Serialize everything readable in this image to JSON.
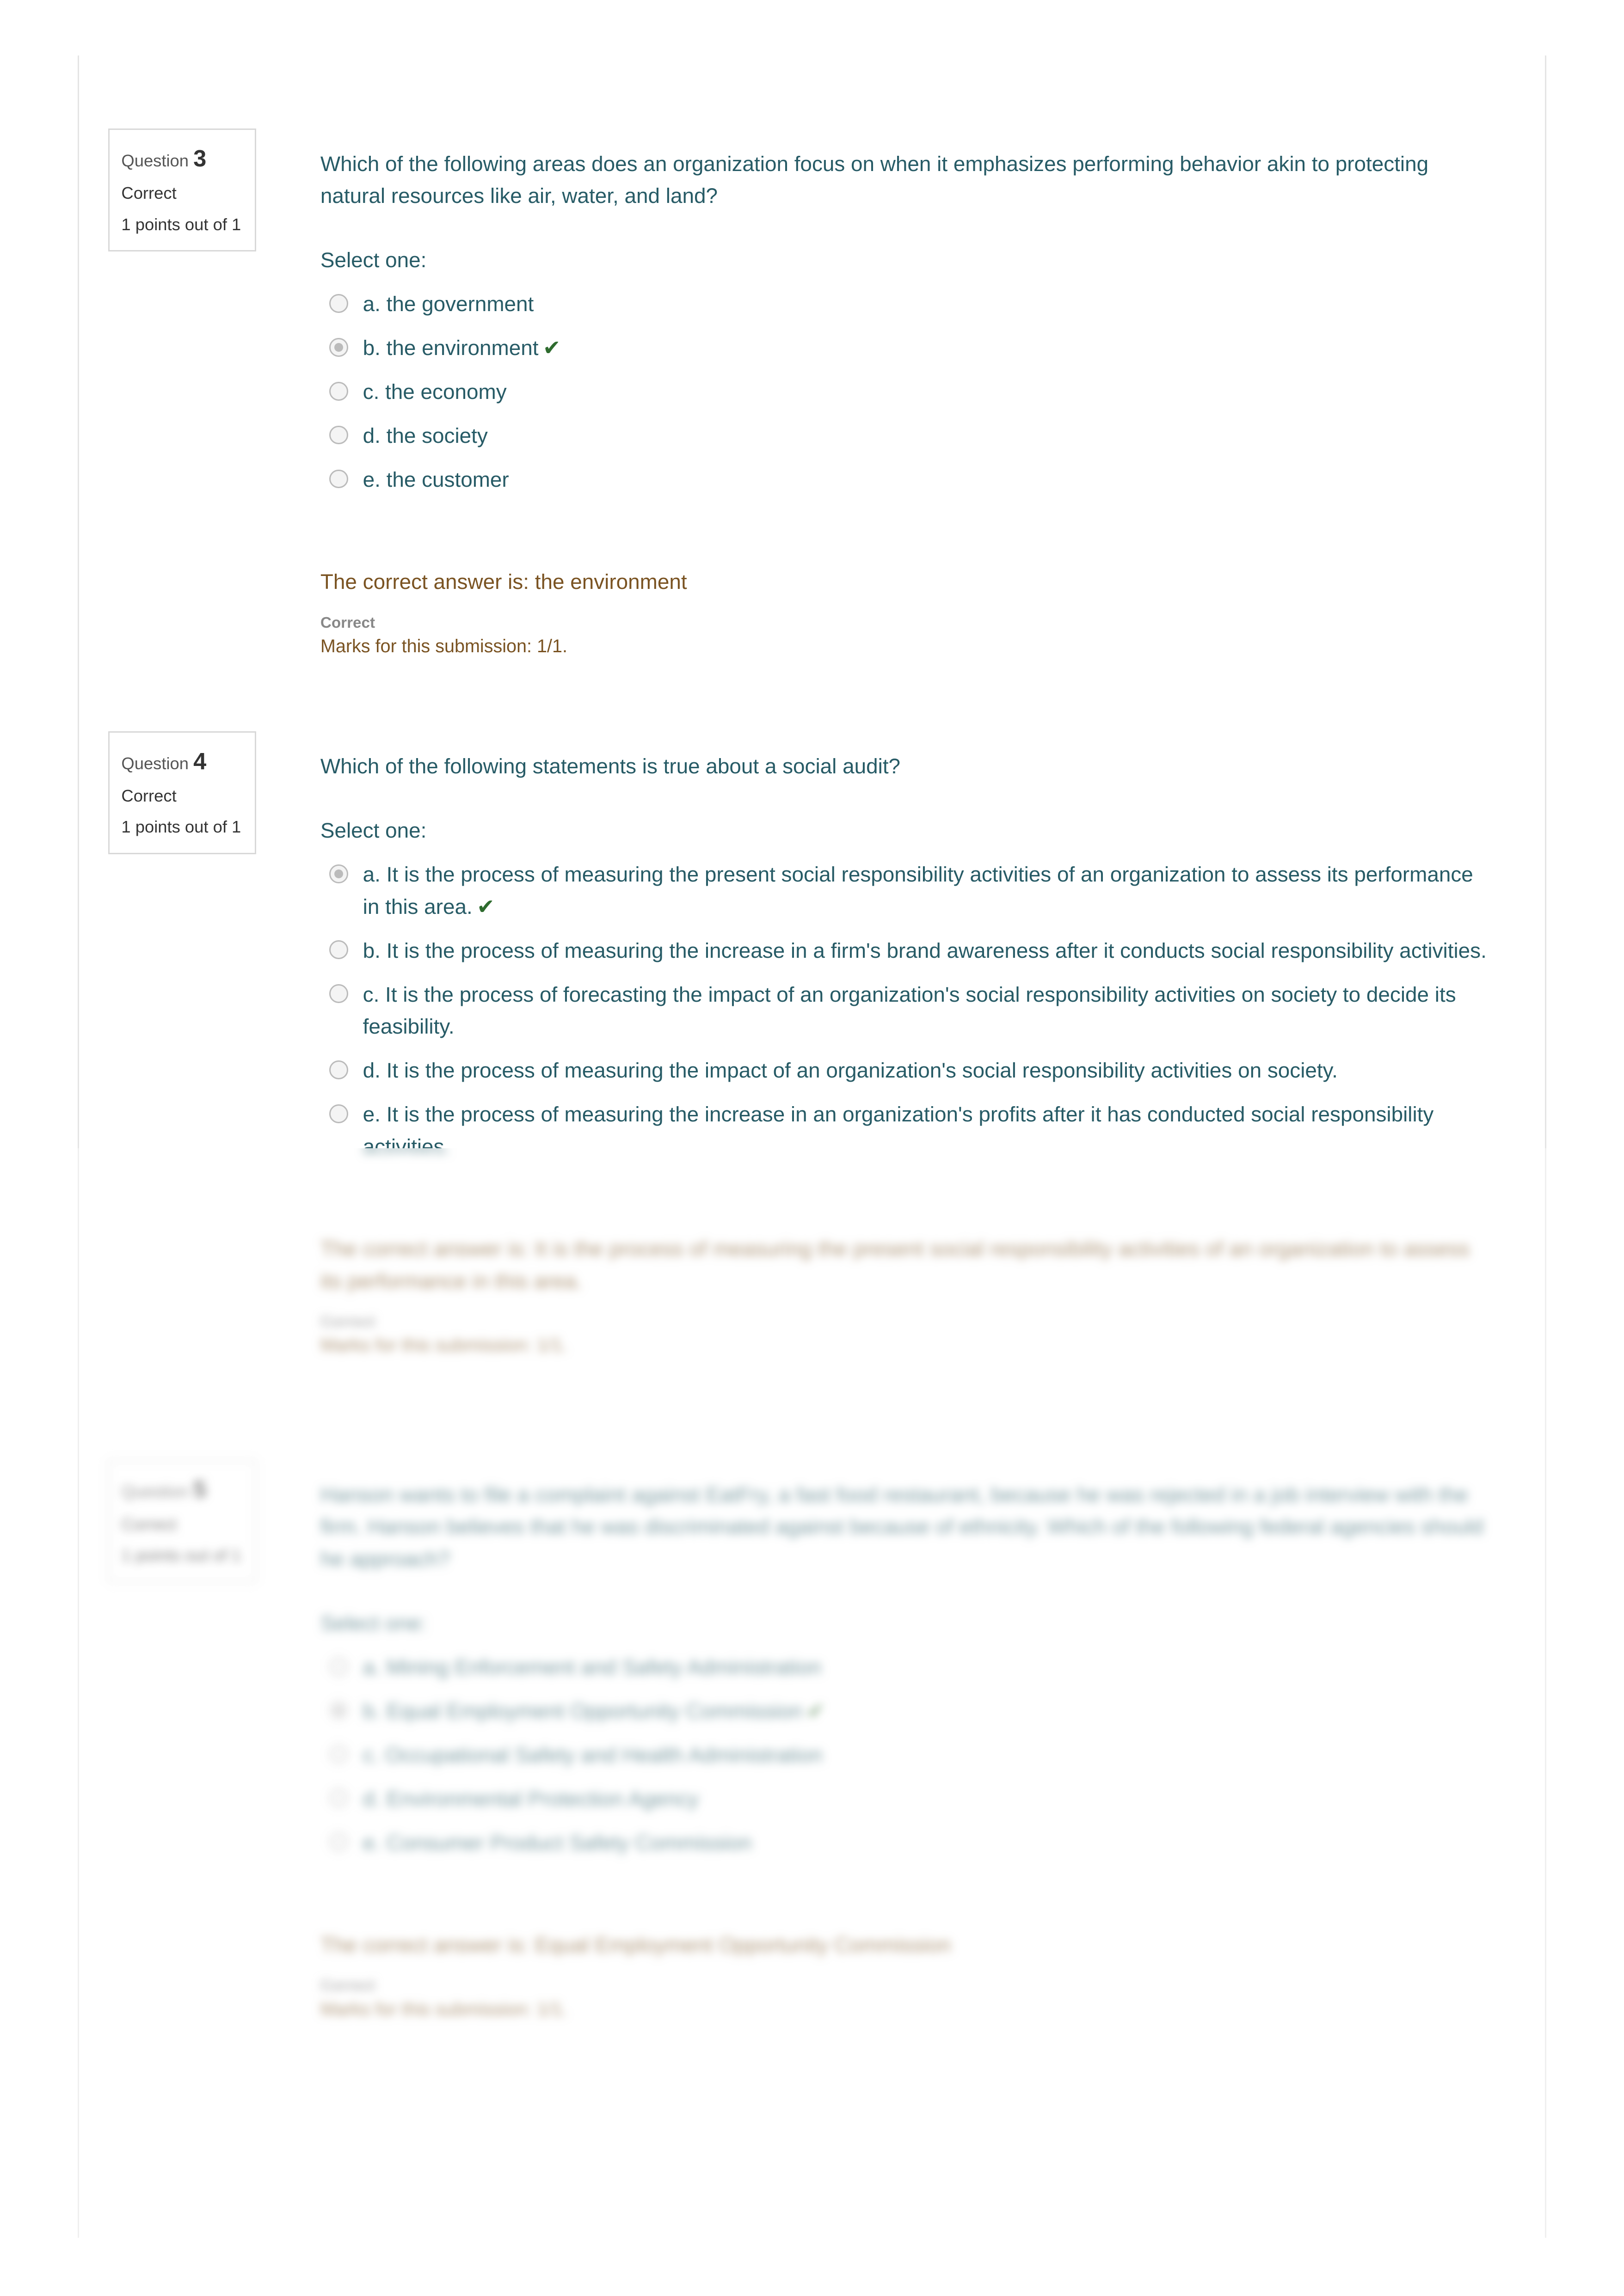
{
  "questions": [
    {
      "label": "Question",
      "number": "3",
      "state": "Correct",
      "points": "1 points out of 1",
      "text": "Which of the following areas does an organization focus on when it emphasizes performing behavior akin to protecting natural resources like air, water, and land?",
      "select_label": "Select one:",
      "options": [
        "a. the government",
        "b. the environment",
        "c. the economy",
        "d. the society",
        "e. the customer"
      ],
      "selected": 1,
      "correct_answer": "The correct answer is: the environment",
      "feedback": "Correct",
      "marks": "Marks for this submission: 1/1."
    },
    {
      "label": "Question",
      "number": "4",
      "state": "Correct",
      "points": "1 points out of 1",
      "text": "Which of the following statements is true about a social audit?",
      "select_label": "Select one:",
      "options": [
        "a. It is the process of measuring the present social responsibility activities of an organization to assess its performance in this area.",
        "b. It is the process of measuring the increase in a firm's brand awareness after it conducts social responsibility activities.",
        "c. It is the process of forecasting the impact of an organization's social responsibility activities on society to decide its feasibility.",
        "d. It is the process of measuring the impact of an organization's social responsibility activities on society.",
        "e. It is the process of measuring the increase in an organization's profits after it has conducted social responsibility activities."
      ],
      "selected": 0,
      "correct_answer": "The correct answer is: It is the process of measuring the present social responsibility activities of an organization to assess its performance in this area.",
      "feedback": "Correct",
      "marks": "Marks for this submission: 1/1."
    },
    {
      "label": "Question",
      "number": "5",
      "state": "Correct",
      "points": "1 points out of 1",
      "text": "Hanson wants to file a complaint against EatFry, a fast food restaurant, because he was rejected in a job interview with the firm. Hanson believes that he was discriminated against because of ethnicity. Which of the following federal agencies should he approach?",
      "select_label": "Select one:",
      "options": [
        "a. Mining Enforcement and Safety Administration",
        "b. Equal Employment Opportunity Commission",
        "c. Occupational Safety and Health Administration",
        "d. Environmental Protection Agency",
        "e. Consumer Product Safety Commission"
      ],
      "selected": 1,
      "correct_answer": "The correct answer is: Equal Employment Opportunity Commission",
      "feedback": "Correct",
      "marks": "Marks for this submission: 1/1."
    }
  ],
  "colors": {
    "question_text": "#275b66",
    "answer_text": "#7a5322",
    "check": "#2e6b2e"
  },
  "icons": {
    "check": "check-icon",
    "radio": "radio-button"
  }
}
